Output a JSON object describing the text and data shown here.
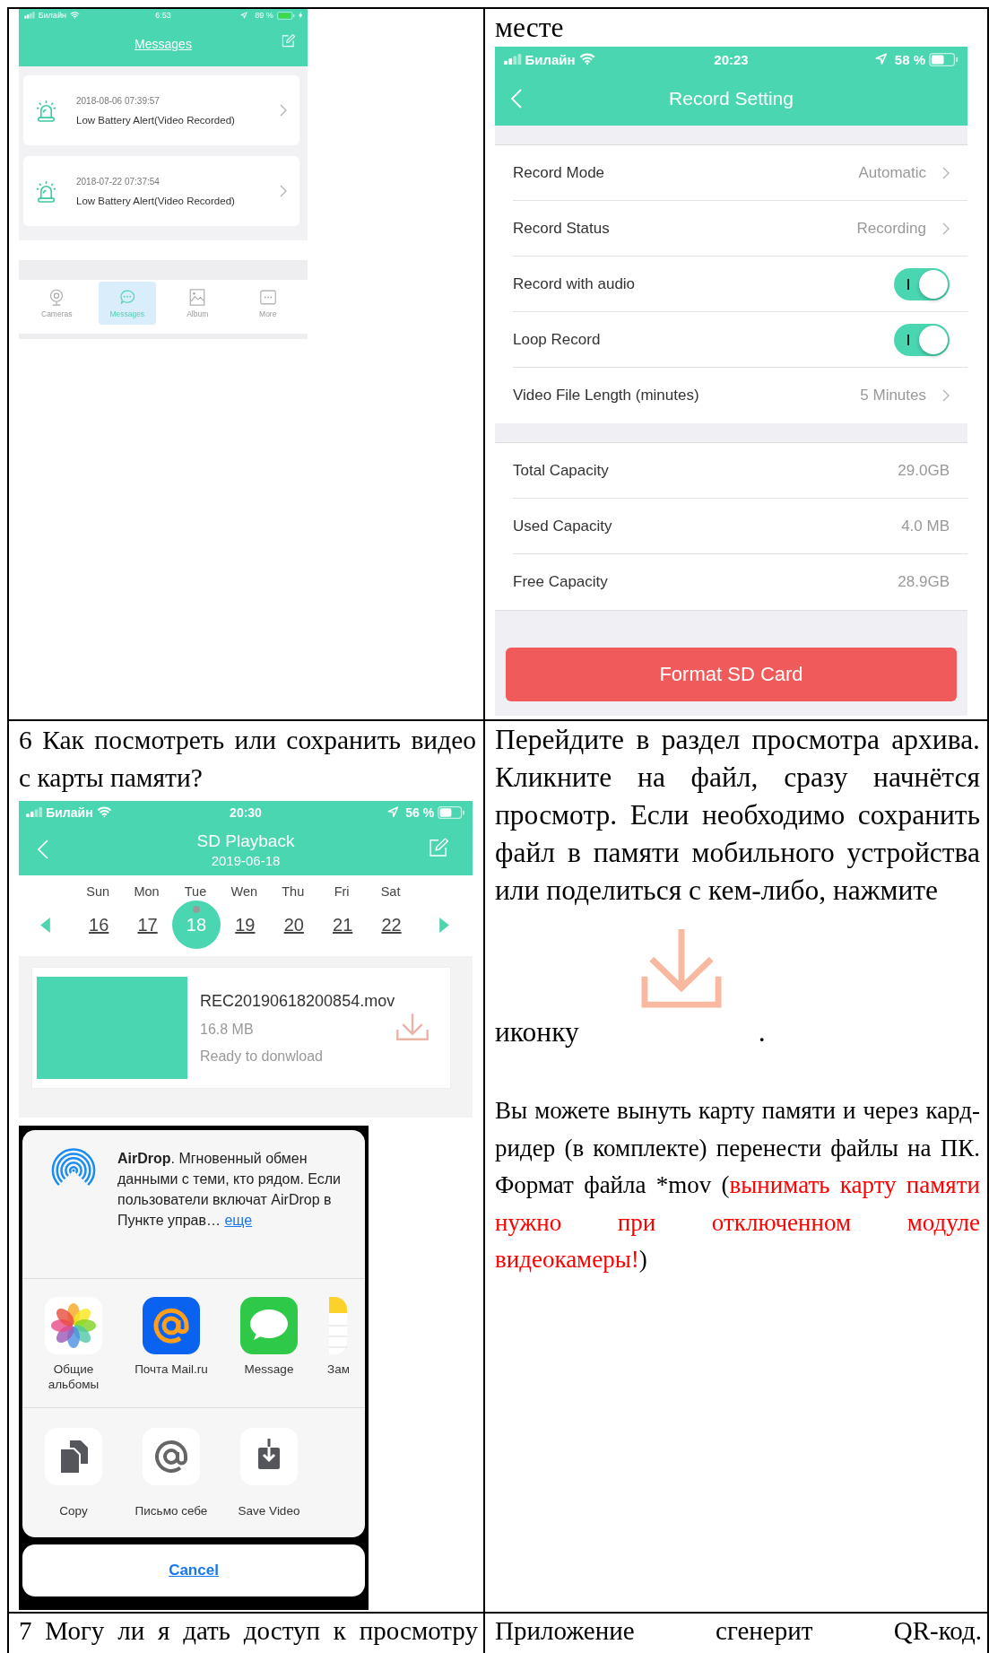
{
  "messages_screen": {
    "status_bar": {
      "carrier": "Билайн",
      "time": "6:53",
      "battery": "89 %",
      "charging": true
    },
    "title": "Messages",
    "messages": [
      {
        "date": "2018-08-06 07:39:57",
        "text": "Low Battery Alert(Video Recorded)"
      },
      {
        "date": "2018-07-22 07:37:54",
        "text": "Low Battery Alert(Video Recorded)"
      }
    ],
    "tab_bar": [
      {
        "kind": "camera",
        "label": "Cameras",
        "selected": false
      },
      {
        "kind": "chat",
        "label": "Messages",
        "selected": true
      },
      {
        "kind": "album",
        "label": "Album",
        "selected": false
      },
      {
        "kind": "more",
        "label": "More",
        "selected": false
      }
    ]
  },
  "record_text": "месте",
  "record_setting_screen": {
    "status_bar": {
      "carrier": "Билайн",
      "time": "20:23",
      "battery": "58 %",
      "charging": false
    },
    "title": "Record Setting",
    "groups": [
      [
        {
          "kind": "link",
          "label": "Record Mode",
          "value": "Automatic"
        },
        {
          "kind": "link",
          "label": "Record Status",
          "value": "Recording"
        },
        {
          "kind": "toggle",
          "label": "Record with audio",
          "on": true
        },
        {
          "kind": "toggle",
          "label": "Loop Record",
          "on": true
        },
        {
          "kind": "link",
          "label": "Video File Length (minutes)",
          "value": "5 Minutes"
        }
      ],
      [
        {
          "kind": "info",
          "label": "Total Capacity",
          "value": "29.0GB"
        },
        {
          "kind": "info",
          "label": "Used Capacity",
          "value": "4.0 MB"
        },
        {
          "kind": "info",
          "label": "Free Capacity",
          "value": "28.9GB"
        }
      ]
    ],
    "button": "Format SD Card"
  },
  "question_6": "6 Как посмотреть или сохранить видео с карты памяти?",
  "playback_screen": {
    "status_bar": {
      "carrier": "Билайн",
      "time": "20:30",
      "battery": "56 %",
      "charging": false
    },
    "title": "SD Playback",
    "date": "2019-06-18",
    "weekdays": [
      "Sun",
      "Mon",
      "Tue",
      "Wen",
      "Thu",
      "Fri",
      "Sat"
    ],
    "days": [
      {
        "label": "16",
        "selected": false
      },
      {
        "label": "17",
        "selected": false
      },
      {
        "label": "18",
        "selected": true
      },
      {
        "label": "19",
        "selected": false
      },
      {
        "label": "20",
        "selected": false
      },
      {
        "label": "21",
        "selected": false
      },
      {
        "label": "22",
        "selected": false
      }
    ],
    "files": [
      {
        "name": "REC20190618200854.mov",
        "size": "16.8 MB",
        "status": "Ready to donwload"
      }
    ]
  },
  "share_sheet": {
    "airdrop_text": "**AirDrop**. Мгновенный обмен данными с теми, кто рядом. Если пользователи включат AirDrop в Пункте управ…",
    "airdrop_link": "еще",
    "apps": [
      {
        "kind": "photos",
        "label": "Общие альбомы"
      },
      {
        "kind": "mail",
        "label": "Почта Mail.ru"
      },
      {
        "kind": "message",
        "label": "Message"
      },
      {
        "kind": "notes",
        "label": "Зам"
      }
    ],
    "actions": [
      {
        "kind": "copy",
        "label": "Copy"
      },
      {
        "kind": "at",
        "label": "Письмо себе"
      },
      {
        "kind": "save",
        "label": "Save Video"
      }
    ],
    "cancel": "Cancel"
  },
  "answer_6": {
    "paragraph": "Перейдите в раздел просмотра архива. Кликните на файл, сразу начнётся просмотр. Если необходимо сохранить файл в памяти мобильного устройства или поделиться с кем-либо, нажмите",
    "icon_word": "иконку",
    "icon_end": ".",
    "note": [
      {
        "kind": "plain",
        "text": "Вы можете вынуть карту памяти и через кард-ридер (в комплекте) перенести файлы на ПК. Формат файла *mov ("
      },
      {
        "kind": "warning",
        "text": "вынимать карту памяти нужно при отключенном модуле видеокамеры!"
      },
      {
        "kind": "plain",
        "text": ")"
      }
    ]
  },
  "question_7": "7 Могу ли я дать доступ к просмотру",
  "answer_7": "Приложение сгенерит QR-код."
}
